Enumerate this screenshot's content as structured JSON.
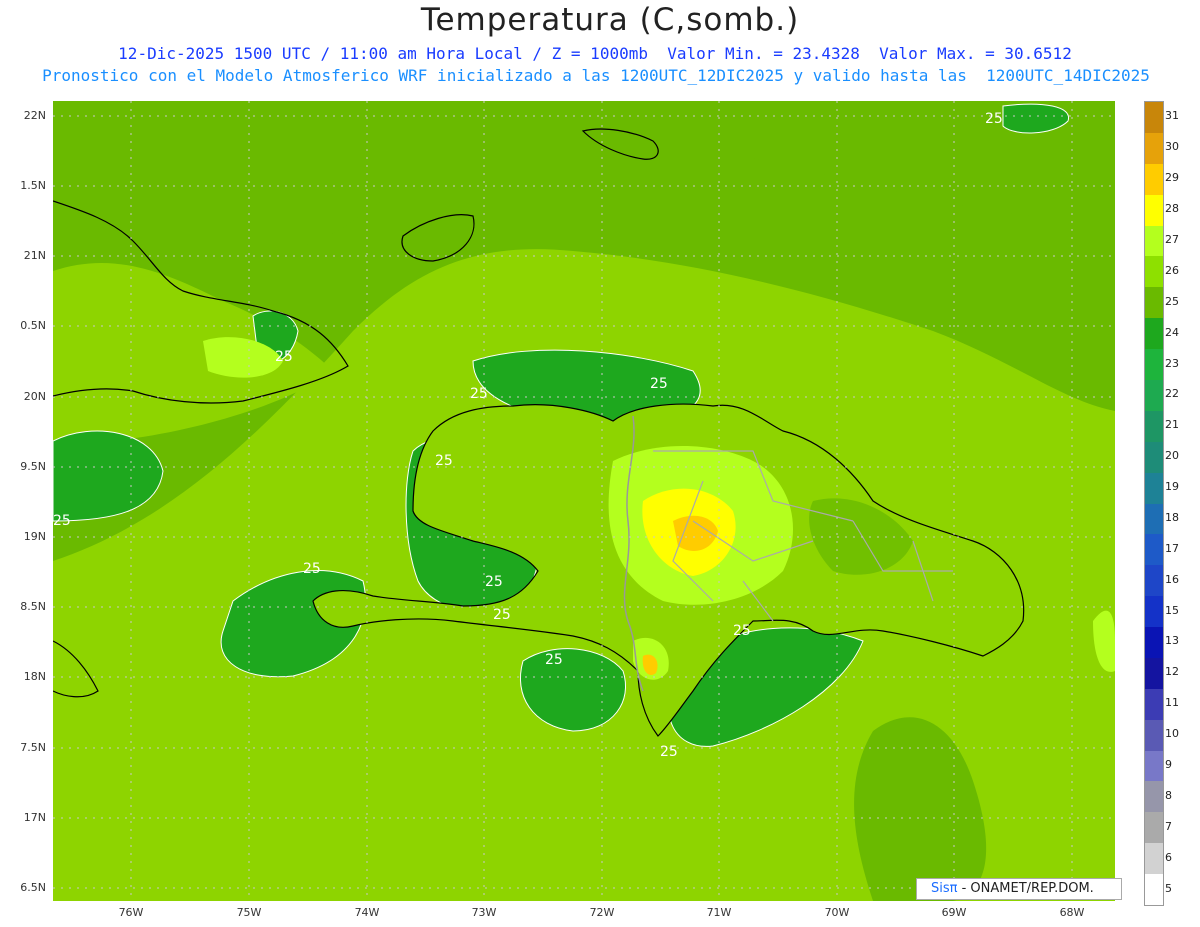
{
  "header": {
    "title": "Temperatura (C,somb.)",
    "line1": "12-Dic-2025 1500 UTC / 11:00 am Hora Local / Z = 1000mb  Valor Min. = 23.4328  Valor Max. = 30.6512",
    "line2": "Pronostico con el Modelo Atmosferico WRF inicializado a las 1200UTC_12DIC2025 y valido hasta las  1200UTC_14DIC2025"
  },
  "lat_labels": [
    "22N",
    "1.5N",
    "21N",
    "0.5N",
    "20N",
    "9.5N",
    "19N",
    "8.5N",
    "18N",
    "7.5N",
    "17N",
    "6.5N"
  ],
  "lon_labels": [
    "76W",
    "75W",
    "74W",
    "73W",
    "72W",
    "71W",
    "70W",
    "69W",
    "68W"
  ],
  "contour_labels": [
    "25",
    "25",
    "25",
    "25",
    "25",
    "25",
    "25",
    "25",
    "25",
    "25",
    "25",
    "25"
  ],
  "legend": {
    "labels": [
      "31",
      "30",
      "29",
      "28",
      "27",
      "26",
      "25",
      "24",
      "23",
      "22",
      "21",
      "20",
      "19",
      "18",
      "17",
      "16",
      "15",
      "13",
      "12",
      "11",
      "10",
      "9",
      "8",
      "7",
      "6",
      "5"
    ],
    "colors": [
      "#c8860a",
      "#e6a20a",
      "#ffcc00",
      "#ffff00",
      "#b4ff1e",
      "#8ee000",
      "#6aba00",
      "#1ea81e",
      "#1eb43c",
      "#1eaa50",
      "#1e9664",
      "#1e8c78",
      "#1e8296",
      "#1e6eb4",
      "#1e5ac8",
      "#1e46c8",
      "#1432c8",
      "#0a14b4",
      "#1414a0",
      "#3c3cb4",
      "#5a5ab4",
      "#7878c8",
      "#9696aa",
      "#aaaaaa",
      "#d2d2d2",
      "#ffffff"
    ]
  },
  "badge": {
    "sis": "Sisπ",
    "text": "- ONAMET/REP.DOM."
  }
}
